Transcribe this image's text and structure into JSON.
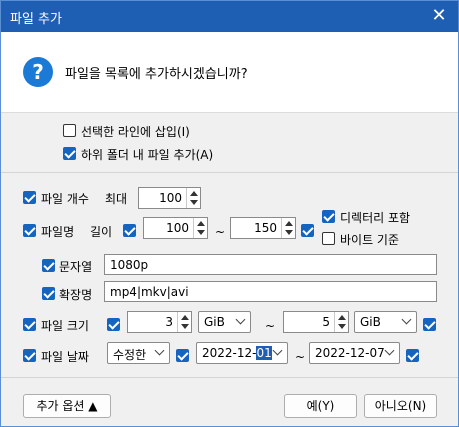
{
  "window": {
    "title": "파일 추가",
    "close_symbol": "✕"
  },
  "prompt": {
    "icon_symbol": "?",
    "text": "파일을 목록에 추가하시겠습니까?"
  },
  "options": {
    "insert_at_selected": {
      "label": "선택한 라인에 삽입(I)",
      "checked": false
    },
    "add_subfolders": {
      "label": "하위 폴더 내 파일 추가(A)",
      "checked": true
    }
  },
  "filters": {
    "file_count": {
      "label": "파일 개수",
      "checked": true,
      "max_label": "최대",
      "max_value": "100"
    },
    "filename": {
      "label": "파일명",
      "checked": true,
      "length_label": "길이",
      "min_checked": true,
      "min_value": "100",
      "tilde": "~",
      "max_value": "150",
      "max_checked": true,
      "include_dir": {
        "label": "디렉터리 포함",
        "checked": true
      },
      "byte_based": {
        "label": "바이트 기준",
        "checked": false
      }
    },
    "string": {
      "label": "문자열",
      "checked": true,
      "value": "1080p"
    },
    "extension": {
      "label": "확장명",
      "checked": true,
      "value": "mp4|mkv|avi"
    },
    "file_size": {
      "label": "파일 크기",
      "checked": true,
      "min_checked": true,
      "min_value": "3",
      "min_unit": "GiB",
      "tilde": "~",
      "max_value": "5",
      "max_unit": "GiB",
      "max_checked": true
    },
    "file_date": {
      "label": "파일 날짜",
      "checked": true,
      "type_value": "수정한",
      "start_checked": true,
      "start_date_prefix": "2022-12-",
      "start_date_selected": "01",
      "tilde": "~",
      "end_date": "2022-12-07",
      "end_checked": true
    }
  },
  "footer": {
    "more_options": "추가 옵션 ▲",
    "yes": "예(Y)",
    "no": "아니오(N)"
  }
}
